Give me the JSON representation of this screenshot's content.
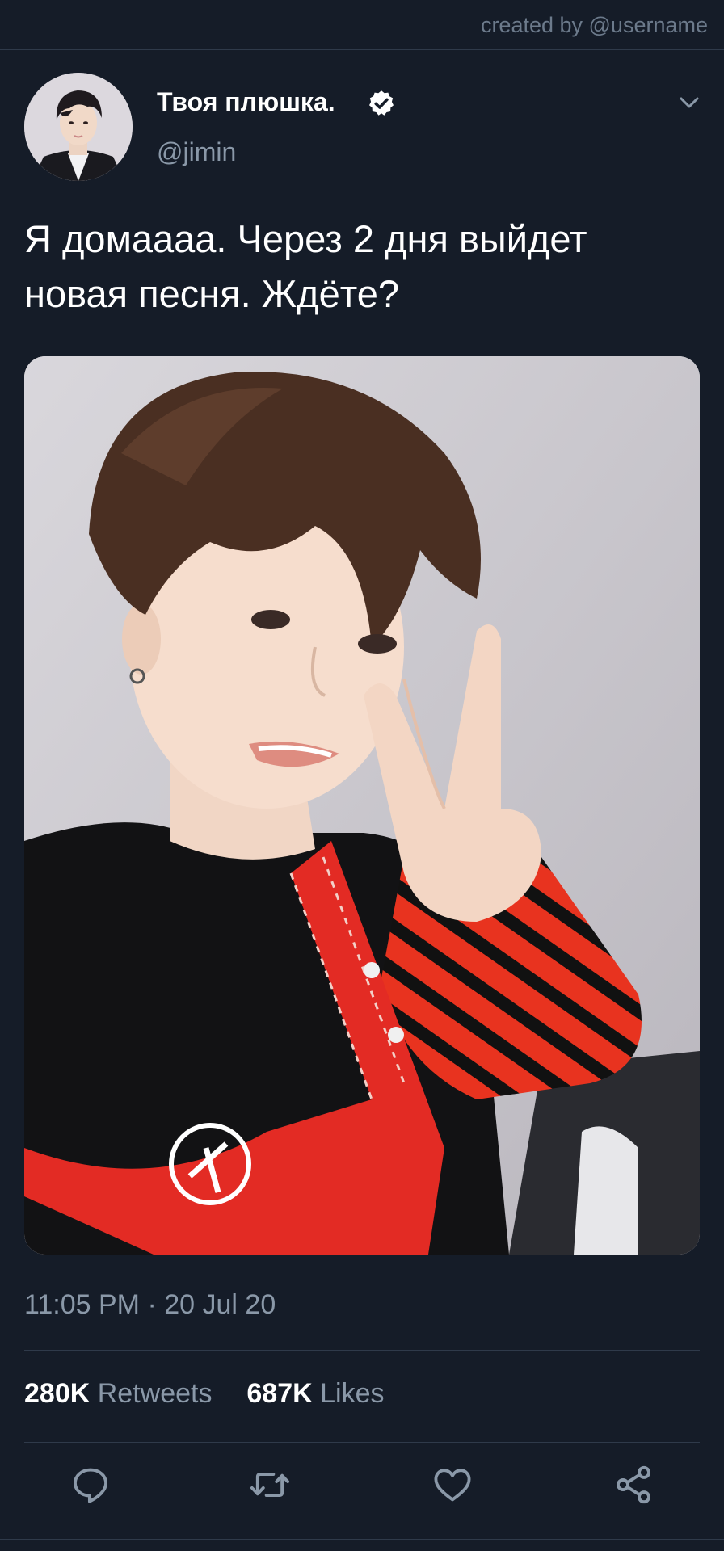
{
  "header": {
    "credit": "created by @username"
  },
  "tweet": {
    "author_name": "Твоя плюшка.",
    "author_handle": "@jimin",
    "text_line1": "Я домаааа. Через 2 дня выйдет",
    "text_line2": "новая песня. Ждёте?",
    "time": "11:05 PM",
    "separator": "·",
    "date": "20 Jul 20"
  },
  "stats": {
    "retweets_count": "280K",
    "retweets_label": "Retweets",
    "likes_count": "687K",
    "likes_label": "Likes"
  },
  "icons": {
    "verified": "verified-badge-icon",
    "more": "chevron-down-icon",
    "reply": "reply-icon",
    "retweet": "retweet-icon",
    "like": "heart-icon",
    "share": "share-icon"
  },
  "colors": {
    "background": "#151c28",
    "secondary_text": "#8a98a8",
    "divider": "#2f3a4a"
  }
}
